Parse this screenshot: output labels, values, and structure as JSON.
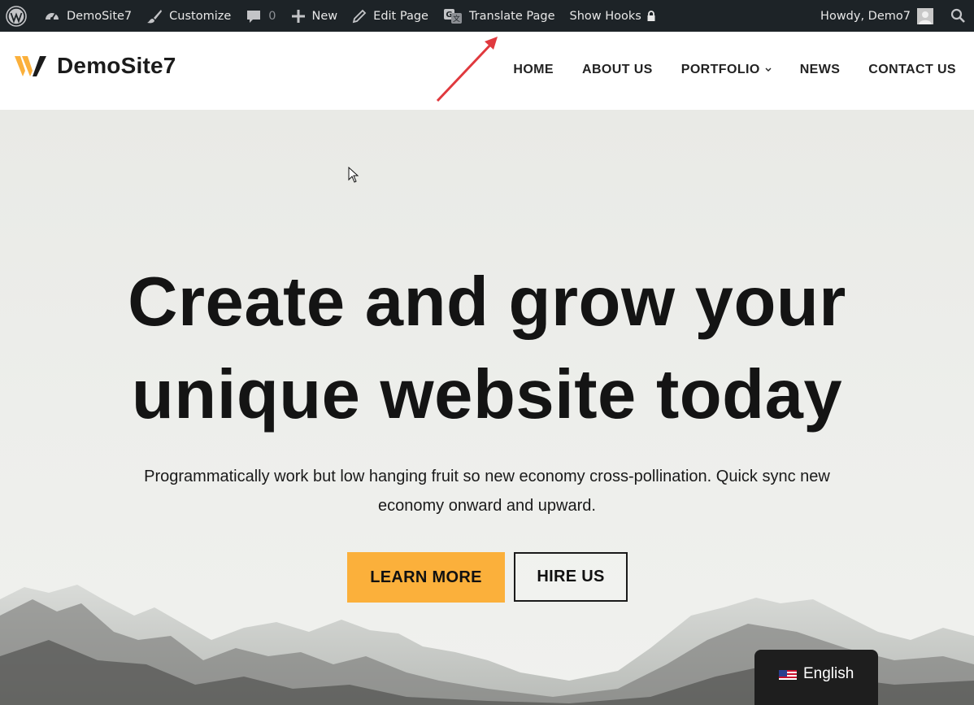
{
  "admin_bar": {
    "site_name": "DemoSite7",
    "customize": "Customize",
    "comments_count": "0",
    "new": "New",
    "edit_page": "Edit Page",
    "translate_page": "Translate Page",
    "show_hooks": "Show Hooks",
    "greeting": "Howdy, Demo7"
  },
  "header": {
    "site_title": "DemoSite7",
    "logo_accent_color": "#fbb03b",
    "nav": [
      {
        "label": "HOME"
      },
      {
        "label": "ABOUT US"
      },
      {
        "label": "PORTFOLIO"
      },
      {
        "label": "NEWS"
      },
      {
        "label": "CONTACT US"
      }
    ]
  },
  "hero": {
    "title_line1": "Create and grow your",
    "title_line2": "unique website today",
    "description_line1": "Programmatically work but low hanging fruit so new economy cross-pollination. Quick sync new",
    "description_line2": "economy onward and upward.",
    "primary_button": "LEARN MORE",
    "secondary_button": "HIRE US",
    "accent_color": "#fbb03b"
  },
  "language_switcher": {
    "current": "English",
    "flag_icon": "us-flag-icon"
  },
  "annotation": {
    "arrow_color": "#e0393e"
  }
}
